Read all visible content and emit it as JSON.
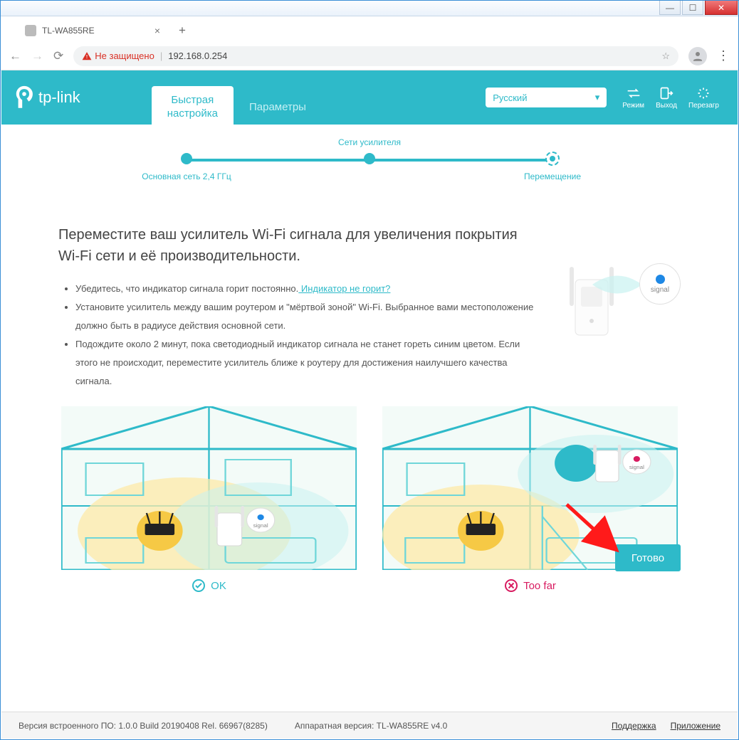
{
  "browser": {
    "tab_title": "TL-WA855RE",
    "url_warning": "Не защищено",
    "url": "192.168.0.254"
  },
  "header": {
    "brand": "tp-link",
    "tab_active": "Быстрая\nнастройка",
    "tab_other": "Параметры",
    "language": "Русский",
    "mode_label": "Режим",
    "logout_label": "Выход",
    "reboot_label": "Перезагр"
  },
  "stepper": {
    "step1": "Основная сеть 2,4 ГГц",
    "step2": "Сети усилителя",
    "step3": "Перемещение"
  },
  "main": {
    "title": "Переместите ваш усилитель Wi-Fi сигнала для увеличения покрытия Wi-Fi сети и её производительности.",
    "b1a": "Убедитесь, что индикатор сигнала горит постоянно.",
    "b1_link": " Индикатор не горит?",
    "b2": "Установите усилитель между вашим роутером и \"мёртвой зоной\" Wi-Fi. Выбранное вами местоположение должно быть в радиусе действия основной сети.",
    "b3": "Подождите около 2 минут, пока светодиодный индикатор сигнала не станет гореть синим цветом. Если этого не происходит, переместите усилитель ближе к роутеру для достижения наилучшего качества сигнала.",
    "signal_label": "signal",
    "ok_label": "OK",
    "toofar_label": "Too far",
    "done_button": "Готово"
  },
  "footer": {
    "fw": "Версия встроенного ПО: 1.0.0 Build 20190408 Rel. 66967(8285)",
    "hw": "Аппаратная версия: TL-WA855RE v4.0",
    "support": "Поддержка",
    "app": "Приложение"
  }
}
